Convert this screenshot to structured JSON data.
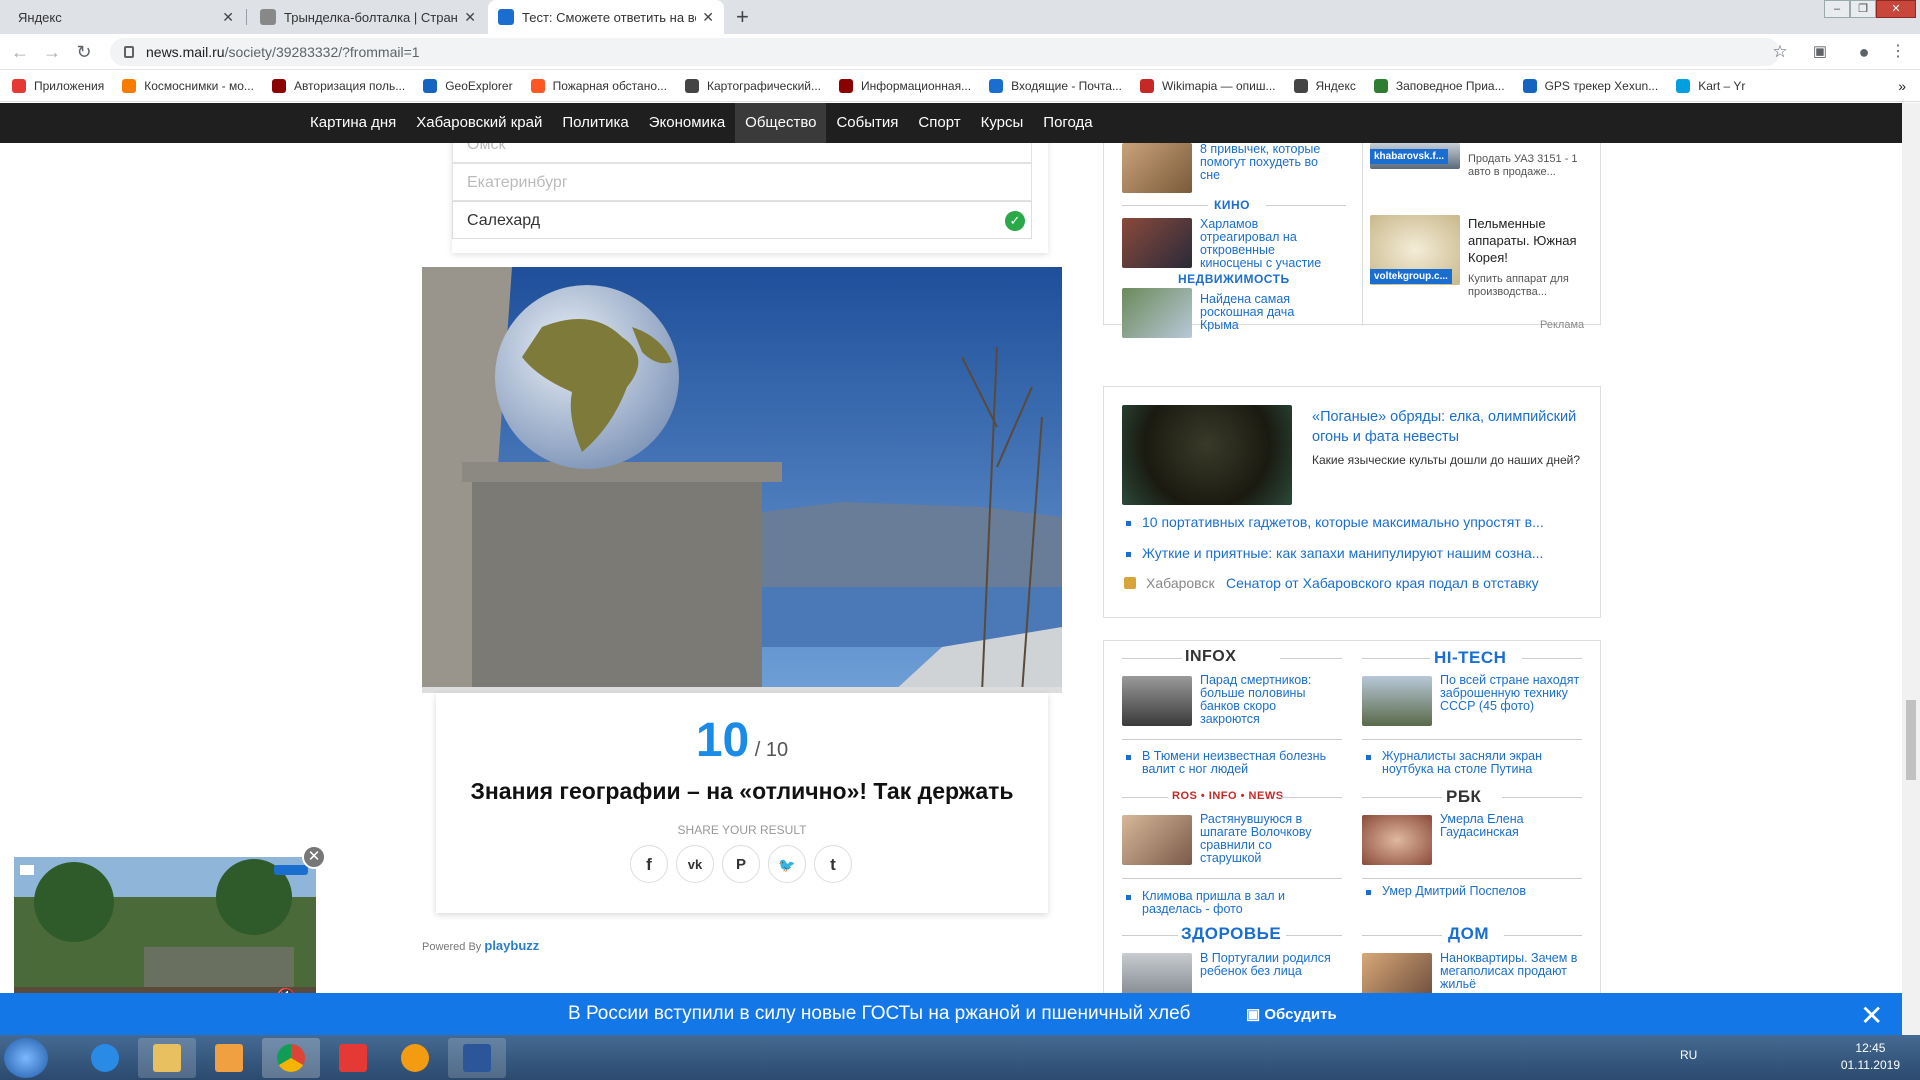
{
  "browser": {
    "tabs": [
      {
        "title": "Яндекс",
        "color": "#ffffff"
      },
      {
        "title": "Трындел­ка-болталка | Страница",
        "color": "#888888"
      },
      {
        "title": "Тест: Сможете ответить на вопр",
        "color": "#1a6ed0"
      }
    ],
    "new_tab": "+",
    "address": {
      "host": "news.mail.ru",
      "path": "/society/39283332/?frommail=1"
    },
    "bookmarks": [
      {
        "label": "Приложения",
        "color": "#e53935"
      },
      {
        "label": "Космоснимки - мо...",
        "color": "#f57c00"
      },
      {
        "label": "Авторизация поль...",
        "color": "#8b0000"
      },
      {
        "label": "GeoExplorer",
        "color": "#1565c0"
      },
      {
        "label": "Пожарная обстано...",
        "color": "#ff5722"
      },
      {
        "label": "Картографический...",
        "color": "#444444"
      },
      {
        "label": "Информационная...",
        "color": "#8b0000"
      },
      {
        "label": "Входящие - Почта...",
        "color": "#1a6ed0"
      },
      {
        "label": "Wikimapia — опиш...",
        "color": "#c62828"
      },
      {
        "label": "Яндекс",
        "color": "#444444"
      },
      {
        "label": "Заповедное Приа...",
        "color": "#2e7d32"
      },
      {
        "label": "GPS трекер Xexun...",
        "color": "#1565c0"
      },
      {
        "label": "Kart – Yr",
        "color": "#00a0e0"
      }
    ],
    "bookmarks_more": "»"
  },
  "site_nav": [
    "Картина дня",
    "Хабаровский край",
    "Политика",
    "Экономика",
    "Общество",
    "События",
    "Спорт",
    "Курсы",
    "Погода"
  ],
  "quiz": {
    "options": [
      {
        "label": "Омск",
        "state": "faded"
      },
      {
        "label": "Екатеринбург",
        "state": "faded"
      },
      {
        "label": "Салехард",
        "state": "correct"
      }
    ],
    "check_mark": "✓",
    "score": "10",
    "score_of": " / 10",
    "result_title": "Знания географии – на «отлично»! Так держать",
    "share_label": "SHARE YOUR RESULT",
    "share_buttons": [
      "f",
      "vk",
      "p",
      "tw",
      "t"
    ],
    "powered_by": "Powered By",
    "brand": "playbuzz"
  },
  "right": {
    "top_panel": {
      "items": [
        {
          "title": "8 привычек, которые помогут похудеть во сне"
        },
        {
          "section": "КИНО",
          "title": "Харламов отреагировал на откровенные киносцены с участие"
        },
        {
          "section": "НЕДВИЖИМОСТЬ",
          "title": "Найдена самая роскошная дача Крыма"
        }
      ],
      "ads": [
        {
          "tag": "khabarovsk.f...",
          "title": "Продать УАЗ 3151 - 1 авто в продаже..."
        },
        {
          "tag": "voltekgroup.c...",
          "title": "Пельменные аппараты. Южная Корея!",
          "subtitle": "Купить аппарат для производства..."
        }
      ],
      "ad_label": "Реклама"
    },
    "feature": {
      "title": "«Поганые» обряды: елка, олимпийский огонь и фата невесты",
      "subtitle": "Какие языческие культы дошли до наших дней?",
      "links": [
        "10 портативных гаджетов, которые максимально упростят в...",
        "Жуткие и приятные: как запахи манипулируют нашим созна..."
      ],
      "local_city": "Хабаровск",
      "local_link": "Сенатор от Хабаровского края подал в отставку"
    },
    "grid": {
      "sections": [
        {
          "name": "INFOX",
          "main": "Парад смертников: больше половины банков скоро закроются",
          "link": "В Тюмени неизвестная болезнь валит с ног людей"
        },
        {
          "name": "HI-TECH",
          "main": "По всей стране находят заброшенную технику СССР (45 фото)",
          "link": "Журналисты засняли экран ноутбука на столе Путина"
        },
        {
          "name": "ROS • INFO • NEWS",
          "main": "Растянувшуюся в шпагате Волочкову сравнили со старушкой",
          "link": "Климова пришла в зал и разделась - фото"
        },
        {
          "name": "РБК",
          "main": "Умерла Елена Гаудасинская",
          "link": "Умер Дмитрий Поспелов"
        },
        {
          "name": "ЗДОРОВЬЕ",
          "main": "В Португалии родился ребенок без лица",
          "link": ""
        },
        {
          "name": "ДОМ",
          "main": "Нанокварти­ры. Зачем в мегаполисах продают жильё",
          "link": ""
        }
      ]
    }
  },
  "banner": {
    "text": "В России вступили в силу новые ГОСТы на ржаной и пшеничный хлеб",
    "discuss": "Обсудить",
    "close": "✕"
  },
  "video": {
    "close": "✕",
    "mute": "🔇"
  },
  "taskbar": {
    "lang": "RU",
    "time": "12:45",
    "date": "01.11.2019"
  }
}
